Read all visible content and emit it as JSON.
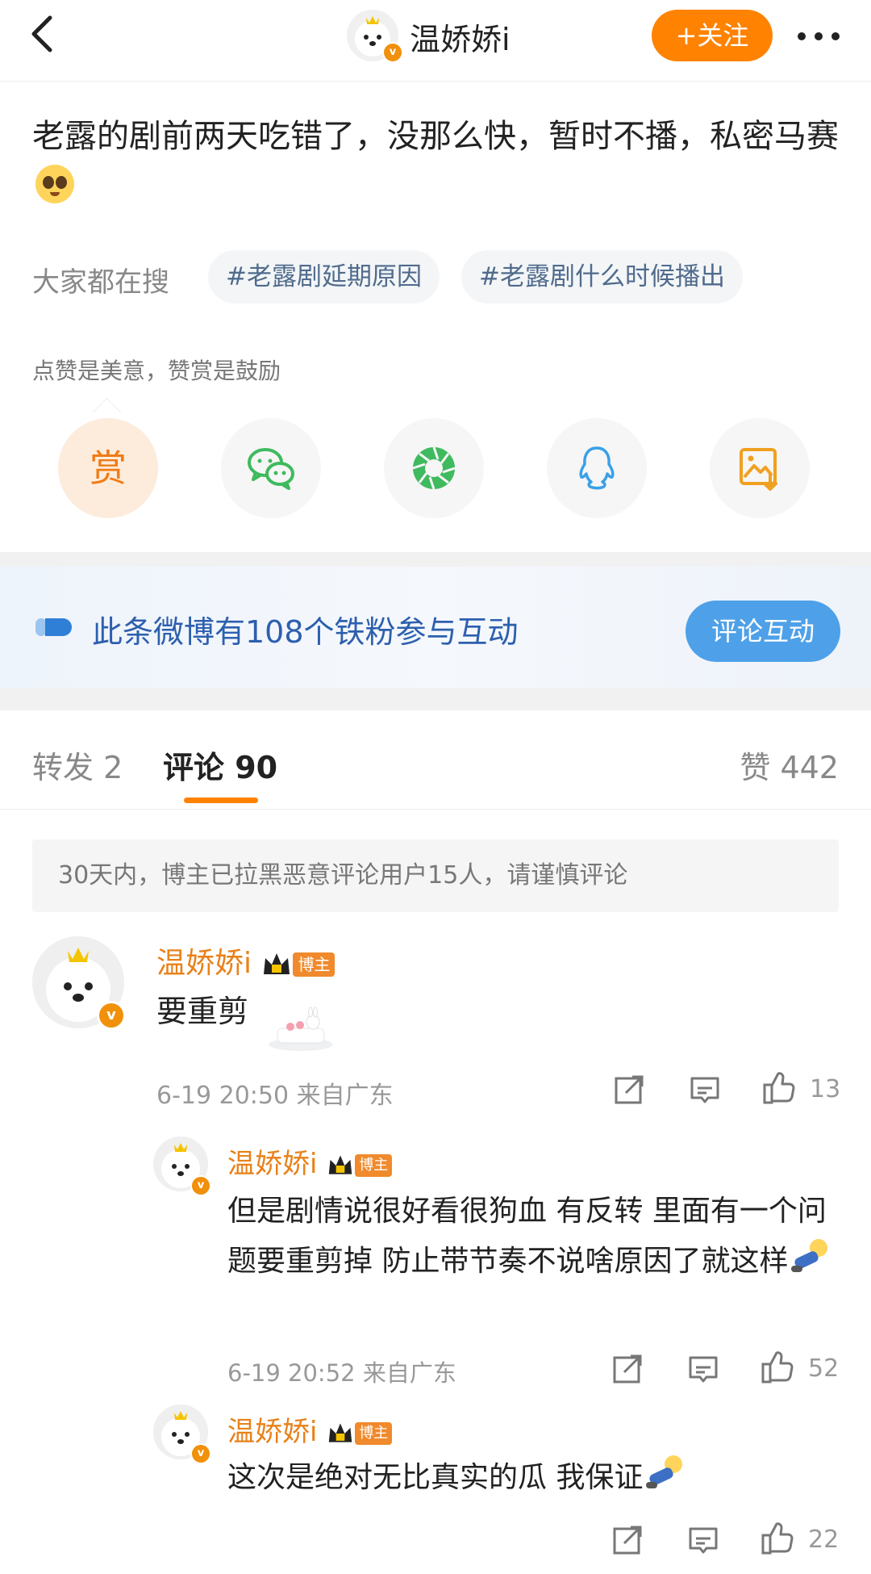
{
  "nav": {
    "username": "温娇娇i",
    "follow_label": "+关注"
  },
  "post": {
    "text": "老露的剧前两天吃错了，没那么快，暂时不播，私密马赛",
    "search_label": "大家都在搜",
    "tags": [
      "#老露剧延期原因",
      "#老露剧什么时候播出"
    ],
    "reward_hint": "点赞是美意，赞赏是鼓励",
    "reward_label": "赏",
    "share_icons": [
      "reward-icon",
      "wechat-icon",
      "moments-icon",
      "qq-icon",
      "save-image-icon"
    ]
  },
  "fans_banner": {
    "text": "此条微博有108个铁粉参与互动",
    "button": "评论互动"
  },
  "tabs": {
    "repost": "转发 2",
    "comment": "评论 90",
    "like": "赞 442"
  },
  "notice": "30天内，博主已拉黑恶意评论用户15人，请谨慎评论",
  "comments": [
    {
      "name": "温娇娇i",
      "badge": "博主",
      "text": "要重剪",
      "time": "6-19 20:50 来自广东",
      "likes": "13"
    },
    {
      "name": "温娇娇i",
      "badge": "博主",
      "text": "但是剧情说很好看很狗血 有反转 里面有一个问题要重剪掉 防止带节奏不说啥原因了就这样",
      "time": "6-19 20:52 来自广东",
      "likes": "52"
    },
    {
      "name": "温娇娇i",
      "badge": "博主",
      "text": "这次是绝对无比真实的瓜 我保证",
      "time": "",
      "likes": "22"
    }
  ],
  "colors": {
    "accent": "#ff8200",
    "name": "#e8811a",
    "link": "#506b8c",
    "banner_text": "#2d5fae",
    "banner_button": "#4ea1e8"
  }
}
